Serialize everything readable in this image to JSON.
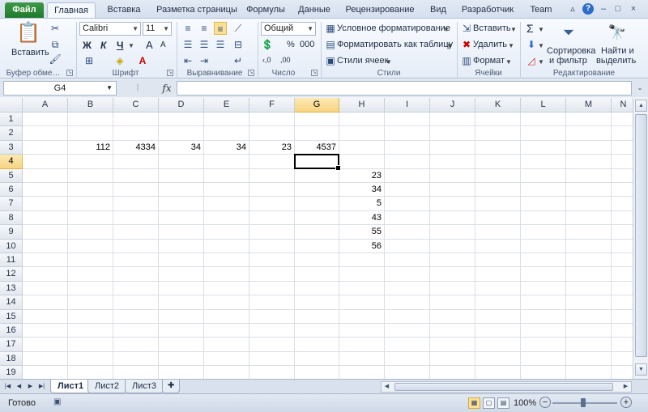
{
  "tabs": {
    "file": "Файл",
    "items": [
      "Главная",
      "Вставка",
      "Разметка страницы",
      "Формулы",
      "Данные",
      "Рецензирование",
      "Вид",
      "Разработчик",
      "Team"
    ],
    "active_index": 0
  },
  "window_controls": {
    "help": "?",
    "minimize": "–",
    "restore": "□",
    "close": "×"
  },
  "ribbon": {
    "clipboard": {
      "paste": "Вставить",
      "label": "Буфер обме…"
    },
    "font": {
      "name": "Calibri",
      "size": "11",
      "bold": "Ж",
      "italic": "К",
      "underline": "Ч",
      "grow": "A",
      "shrink": "A",
      "label": "Шрифт"
    },
    "alignment": {
      "label": "Выравнивание"
    },
    "number": {
      "format": "Общий",
      "percent": "%",
      "thousands": "000",
      "inc": "‹,0",
      "dec": ",00",
      "label": "Число"
    },
    "styles": {
      "conditional": "Условное форматирование",
      "table": "Форматировать как таблицу",
      "cell_styles": "Стили ячеек",
      "label": "Стили"
    },
    "cells": {
      "insert": "Вставить",
      "delete": "Удалить",
      "format": "Формат",
      "label": "Ячейки"
    },
    "editing": {
      "sort_line1": "Сортировка",
      "sort_line2": "и фильтр",
      "find_line1": "Найти и",
      "find_line2": "выделить",
      "label": "Редактирование",
      "sigma": "Σ"
    }
  },
  "formula_bar": {
    "name_box": "G4",
    "fx": "fx",
    "formula": ""
  },
  "columns": [
    "A",
    "B",
    "C",
    "D",
    "E",
    "F",
    "G",
    "H",
    "I",
    "J",
    "K",
    "L",
    "M",
    "N"
  ],
  "rows": [
    "1",
    "2",
    "3",
    "4",
    "5",
    "6",
    "7",
    "8",
    "9",
    "10",
    "11",
    "12",
    "13",
    "14",
    "15",
    "16",
    "17",
    "18",
    "19"
  ],
  "selected": {
    "column": "G",
    "row": "4"
  },
  "cells": [
    {
      "col": "B",
      "row": 3,
      "value": "112"
    },
    {
      "col": "C",
      "row": 3,
      "value": "4334"
    },
    {
      "col": "D",
      "row": 3,
      "value": "34"
    },
    {
      "col": "E",
      "row": 3,
      "value": "34"
    },
    {
      "col": "F",
      "row": 3,
      "value": "23"
    },
    {
      "col": "G",
      "row": 3,
      "value": "4537"
    },
    {
      "col": "H",
      "row": 5,
      "value": "23"
    },
    {
      "col": "H",
      "row": 6,
      "value": "34"
    },
    {
      "col": "H",
      "row": 7,
      "value": "5"
    },
    {
      "col": "H",
      "row": 8,
      "value": "43"
    },
    {
      "col": "H",
      "row": 9,
      "value": "55"
    },
    {
      "col": "H",
      "row": 10,
      "value": "56"
    }
  ],
  "sheets": {
    "items": [
      "Лист1",
      "Лист2",
      "Лист3"
    ],
    "active_index": 0
  },
  "status": {
    "ready": "Готово",
    "zoom": "100%",
    "minus": "−",
    "plus": "+"
  },
  "colors": {
    "file_tab": "#2a8a36",
    "selected_header": "#f7d480",
    "grid_line": "#dadfe6"
  }
}
